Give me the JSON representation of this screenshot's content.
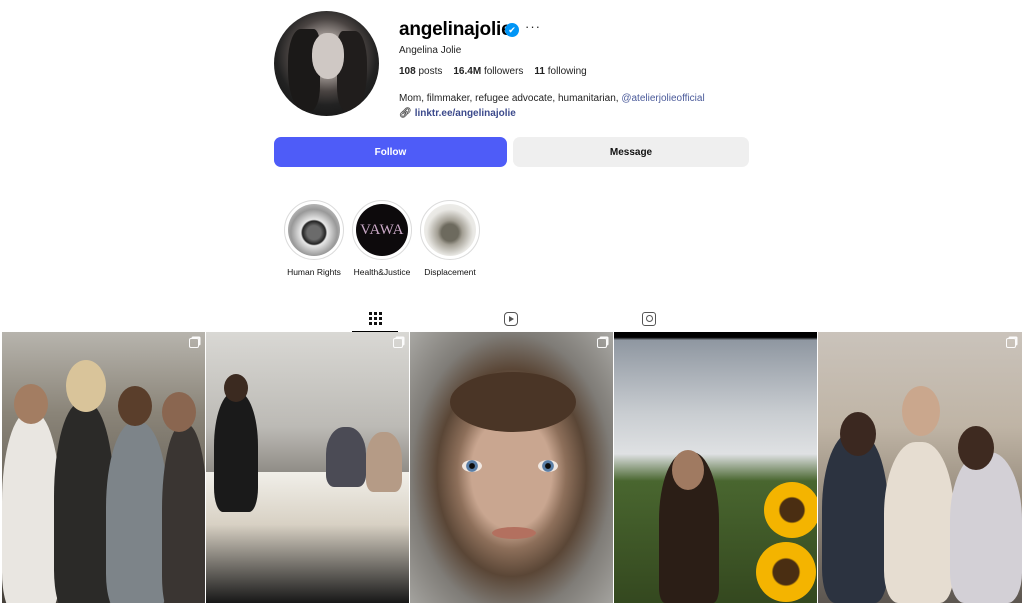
{
  "profile": {
    "username": "angelinajolie",
    "verified_icon": "verified-badge-icon",
    "more_icon": "more-options-icon",
    "full_name": "Angelina Jolie",
    "stats": {
      "posts_count": "108",
      "posts_label": "posts",
      "followers_count": "16.4M",
      "followers_label": "followers",
      "following_count": "11",
      "following_label": "following"
    },
    "bio_text": "Mom, filmmaker, refugee advocate, humanitarian, ",
    "bio_mention": "@atelierjolieofficial",
    "link_icon": "link-icon",
    "link_text": "linktr.ee/angelinajolie"
  },
  "actions": {
    "follow_label": "Follow",
    "message_label": "Message"
  },
  "highlights": [
    {
      "label": "Human Rights"
    },
    {
      "label": "Health&Justice",
      "cover_text": "VAWA"
    },
    {
      "label": "Displacement"
    }
  ],
  "tabs": [
    {
      "name": "posts",
      "icon": "grid-icon",
      "active": true
    },
    {
      "name": "reels",
      "icon": "reels-icon",
      "active": false
    },
    {
      "name": "tagged",
      "icon": "tagged-icon",
      "active": false
    }
  ],
  "posts": [
    {
      "type": "carousel",
      "icon": "multiple-images-icon"
    },
    {
      "type": "carousel",
      "icon": "multiple-images-icon"
    },
    {
      "type": "carousel",
      "icon": "multiple-images-icon"
    },
    {
      "type": "image"
    },
    {
      "type": "carousel",
      "icon": "multiple-images-icon"
    }
  ],
  "colors": {
    "follow_button": "#4e5cf8",
    "message_button": "#efefef",
    "verified": "#0095f6",
    "link": "#3c4a8c"
  }
}
